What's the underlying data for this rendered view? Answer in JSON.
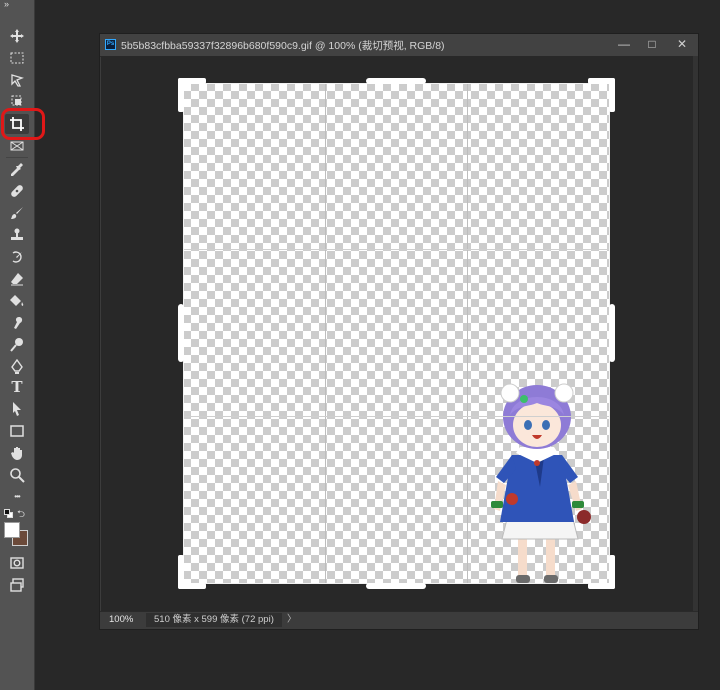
{
  "toolbar": {
    "collapse_glyph": "»",
    "tools": [
      {
        "id": "move",
        "icon": "move-icon"
      },
      {
        "id": "marquee",
        "icon": "rect-marquee-icon"
      },
      {
        "id": "lasso",
        "icon": "lasso-icon"
      },
      {
        "id": "object-select",
        "icon": "object-select-icon"
      },
      {
        "id": "crop",
        "icon": "crop-icon",
        "active": true
      },
      {
        "id": "frame",
        "icon": "frame-icon"
      },
      {
        "id": "eyedropper",
        "icon": "eyedropper-icon"
      },
      {
        "id": "healing",
        "icon": "bandage-icon"
      },
      {
        "id": "brush",
        "icon": "brush-icon"
      },
      {
        "id": "stamp",
        "icon": "stamp-icon"
      },
      {
        "id": "history-brush",
        "icon": "history-brush-icon"
      },
      {
        "id": "eraser",
        "icon": "eraser-icon"
      },
      {
        "id": "bucket",
        "icon": "paint-bucket-icon"
      },
      {
        "id": "smudge",
        "icon": "smudge-icon"
      },
      {
        "id": "dodge",
        "icon": "dodge-icon"
      },
      {
        "id": "pen",
        "icon": "pen-icon"
      },
      {
        "id": "type",
        "icon": "type-icon",
        "glyph": "T"
      },
      {
        "id": "path-select",
        "icon": "path-select-icon"
      },
      {
        "id": "shape",
        "icon": "rectangle-icon"
      },
      {
        "id": "hand",
        "icon": "hand-icon"
      },
      {
        "id": "zoom",
        "icon": "zoom-icon"
      },
      {
        "id": "more",
        "icon": "more-icon",
        "glyph": "•••"
      }
    ],
    "foreground_color": "#ffffff",
    "background_color": "#6b4a3a"
  },
  "document": {
    "badge": "Ps",
    "title": "5b5b83cfbba59337f32896b680f590c9.gif @ 100% (裁切预视, RGB/8)",
    "window_controls": {
      "minimize": "—",
      "maximize": "□",
      "close": "✕"
    }
  },
  "status": {
    "zoom": "100%",
    "info": "510 像素 x 599 像素 (72 ppi)",
    "arrow": "〉"
  },
  "colors": {
    "highlight": "#e01818",
    "canvas_bg": "#282828",
    "panel_bg": "#535353"
  }
}
